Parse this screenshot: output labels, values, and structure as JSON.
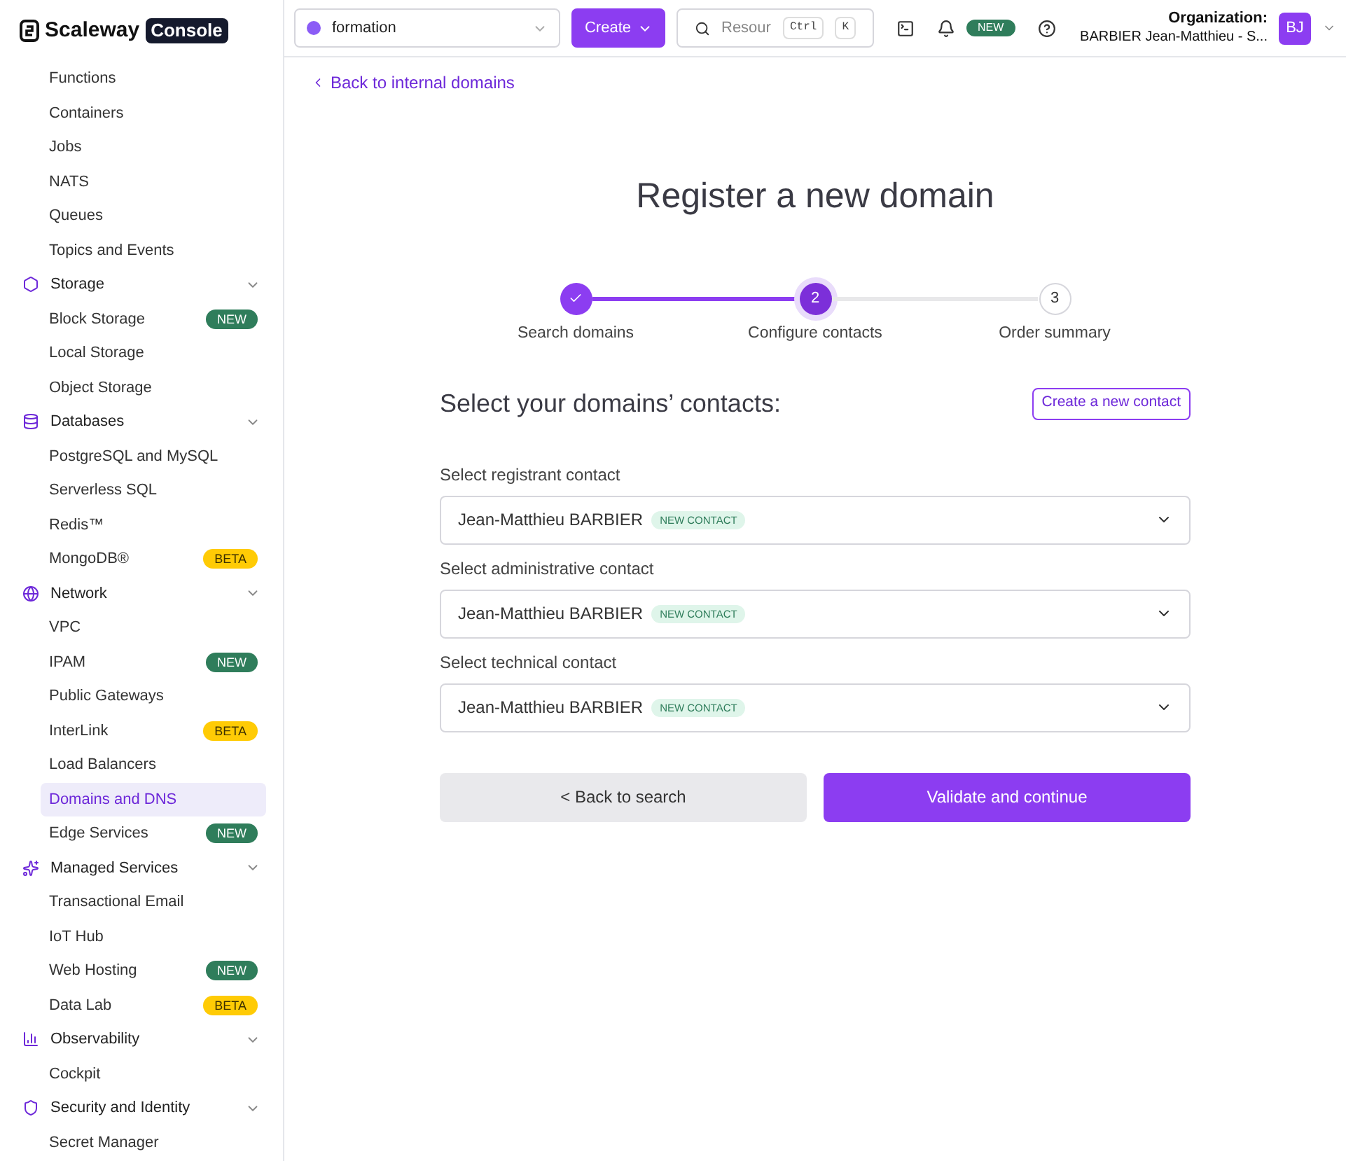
{
  "brand": {
    "name": "Scaleway",
    "product": "Console"
  },
  "sidebar": {
    "items": [
      {
        "kind": "item",
        "label": "Functions",
        "selected": false
      },
      {
        "kind": "item",
        "label": "Containers",
        "selected": false
      },
      {
        "kind": "item",
        "label": "Jobs",
        "selected": false
      },
      {
        "kind": "item",
        "label": "NATS",
        "selected": false
      },
      {
        "kind": "item",
        "label": "Queues",
        "selected": false
      },
      {
        "kind": "item",
        "label": "Topics and Events",
        "selected": false
      },
      {
        "kind": "section",
        "label": "Storage",
        "expanded": true
      },
      {
        "kind": "item",
        "label": "Block Storage",
        "selected": false,
        "badge": {
          "kind": "new",
          "text": "NEW"
        }
      },
      {
        "kind": "item",
        "label": "Local Storage",
        "selected": false
      },
      {
        "kind": "item",
        "label": "Object Storage",
        "selected": false
      },
      {
        "kind": "section",
        "label": "Databases",
        "expanded": true
      },
      {
        "kind": "item",
        "label": "PostgreSQL and MySQL",
        "selected": false
      },
      {
        "kind": "item",
        "label": "Serverless SQL",
        "selected": false
      },
      {
        "kind": "item",
        "label": "Redis™",
        "selected": false
      },
      {
        "kind": "item",
        "label": "MongoDB®",
        "selected": false,
        "badge": {
          "kind": "beta",
          "text": "BETA"
        }
      },
      {
        "kind": "section",
        "label": "Network",
        "expanded": true
      },
      {
        "kind": "item",
        "label": "VPC",
        "selected": false
      },
      {
        "kind": "item",
        "label": "IPAM",
        "selected": false,
        "badge": {
          "kind": "new",
          "text": "NEW"
        }
      },
      {
        "kind": "item",
        "label": "Public Gateways",
        "selected": false
      },
      {
        "kind": "item",
        "label": "InterLink",
        "selected": false,
        "badge": {
          "kind": "beta",
          "text": "BETA"
        }
      },
      {
        "kind": "item",
        "label": "Load Balancers",
        "selected": false
      },
      {
        "kind": "item",
        "label": "Domains and DNS",
        "selected": true
      },
      {
        "kind": "item",
        "label": "Edge Services",
        "selected": false,
        "badge": {
          "kind": "new",
          "text": "NEW"
        }
      },
      {
        "kind": "section",
        "label": "Managed Services",
        "expanded": true
      },
      {
        "kind": "item",
        "label": "Transactional Email",
        "selected": false
      },
      {
        "kind": "item",
        "label": "IoT Hub",
        "selected": false
      },
      {
        "kind": "item",
        "label": "Web Hosting",
        "selected": false,
        "badge": {
          "kind": "new",
          "text": "NEW"
        }
      },
      {
        "kind": "item",
        "label": "Data Lab",
        "selected": false,
        "badge": {
          "kind": "beta",
          "text": "BETA"
        }
      },
      {
        "kind": "section",
        "label": "Observability",
        "expanded": true
      },
      {
        "kind": "item",
        "label": "Cockpit",
        "selected": false
      },
      {
        "kind": "section",
        "label": "Security and Identity",
        "expanded": true
      },
      {
        "kind": "item",
        "label": "Secret Manager",
        "selected": false
      }
    ]
  },
  "topbar": {
    "project": "formation",
    "create": "Create",
    "search": {
      "placeholder": "Resour",
      "keys": [
        "Ctrl",
        "K"
      ]
    },
    "notifications_badge": "NEW",
    "organization_label": "Organization:",
    "organization": "BARBIER Jean-Matthieu - S...",
    "avatar": "BJ"
  },
  "back_link": "Back to internal domains",
  "title": "Register a new domain",
  "steps": [
    {
      "label": "Search domains",
      "completed": true,
      "selected": false
    },
    {
      "number": "2",
      "label": "Configure contacts",
      "completed": false,
      "selected": true
    },
    {
      "number": "3",
      "label": "Order summary",
      "completed": false,
      "selected": false
    }
  ],
  "section_title": "Select your domains’ contacts:",
  "create_contact": "Create a new contact",
  "contacts": [
    {
      "label": "Select registrant contact",
      "value": "Jean-Matthieu BARBIER",
      "tag": "NEW CONTACT"
    },
    {
      "label": "Select administrative contact",
      "value": "Jean-Matthieu BARBIER",
      "tag": "NEW CONTACT"
    },
    {
      "label": "Select technical contact",
      "value": "Jean-Matthieu BARBIER",
      "tag": "NEW CONTACT"
    }
  ],
  "buttons": {
    "back": "< Back to search",
    "next": "Validate and continue"
  }
}
